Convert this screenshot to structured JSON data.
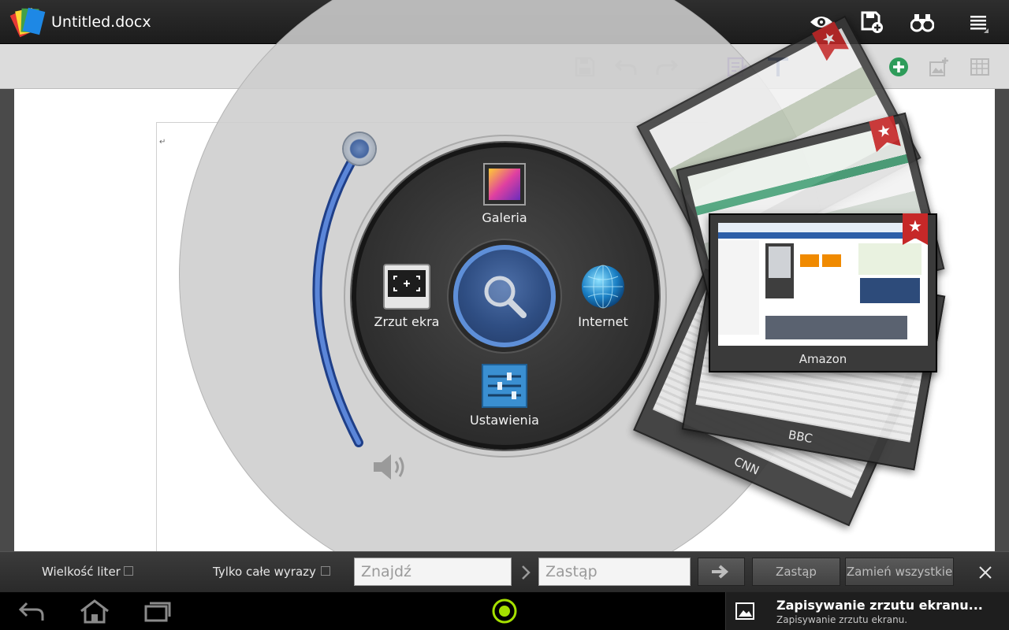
{
  "header": {
    "title": "Untitled.docx",
    "icons": [
      "app-logo-icon",
      "eye-icon",
      "save-add-icon",
      "binoculars-icon",
      "menu-icon"
    ]
  },
  "toolbar": {
    "icons": [
      "save-icon",
      "undo-icon",
      "redo-icon",
      "edit-icon",
      "text-format-icon",
      "add-icon",
      "image-icon",
      "table-icon"
    ]
  },
  "document": {
    "paragraph_mark": "↵"
  },
  "radial_menu": {
    "items": [
      {
        "id": "galeria",
        "label": "Galeria"
      },
      {
        "id": "zrzut",
        "label": "Zrzut ekra"
      },
      {
        "id": "internet",
        "label": "Internet"
      },
      {
        "id": "ustawienia",
        "label": "Ustawienia"
      }
    ],
    "center_icon": "search-icon",
    "volume_icon": "speaker-icon"
  },
  "browser_tabs": [
    {
      "label": ""
    },
    {
      "label": ""
    },
    {
      "label": "Amazon"
    },
    {
      "label": "BBC"
    },
    {
      "label": "CNN"
    }
  ],
  "findbar": {
    "match_case_label": "Wielkość liter",
    "whole_words_label": "Tylko całe wyrazy",
    "find_placeholder": "Znajdź",
    "replace_placeholder": "Zastąp",
    "replace_button": "Zastąp",
    "replace_all_button": "Zamień wszystkie"
  },
  "navbar": {
    "icons": [
      "back-icon",
      "home-icon",
      "recent-apps-icon",
      "ring-menu-icon"
    ]
  },
  "notification": {
    "title": "Zapisywanie zrzutu ekranu...",
    "subtitle": "Zapisywanie zrzutu ekranu."
  },
  "colors": {
    "accent_blue": "#5e8fd8",
    "bookmark_red": "#c62828",
    "ring_indicator": "#a5e000"
  }
}
